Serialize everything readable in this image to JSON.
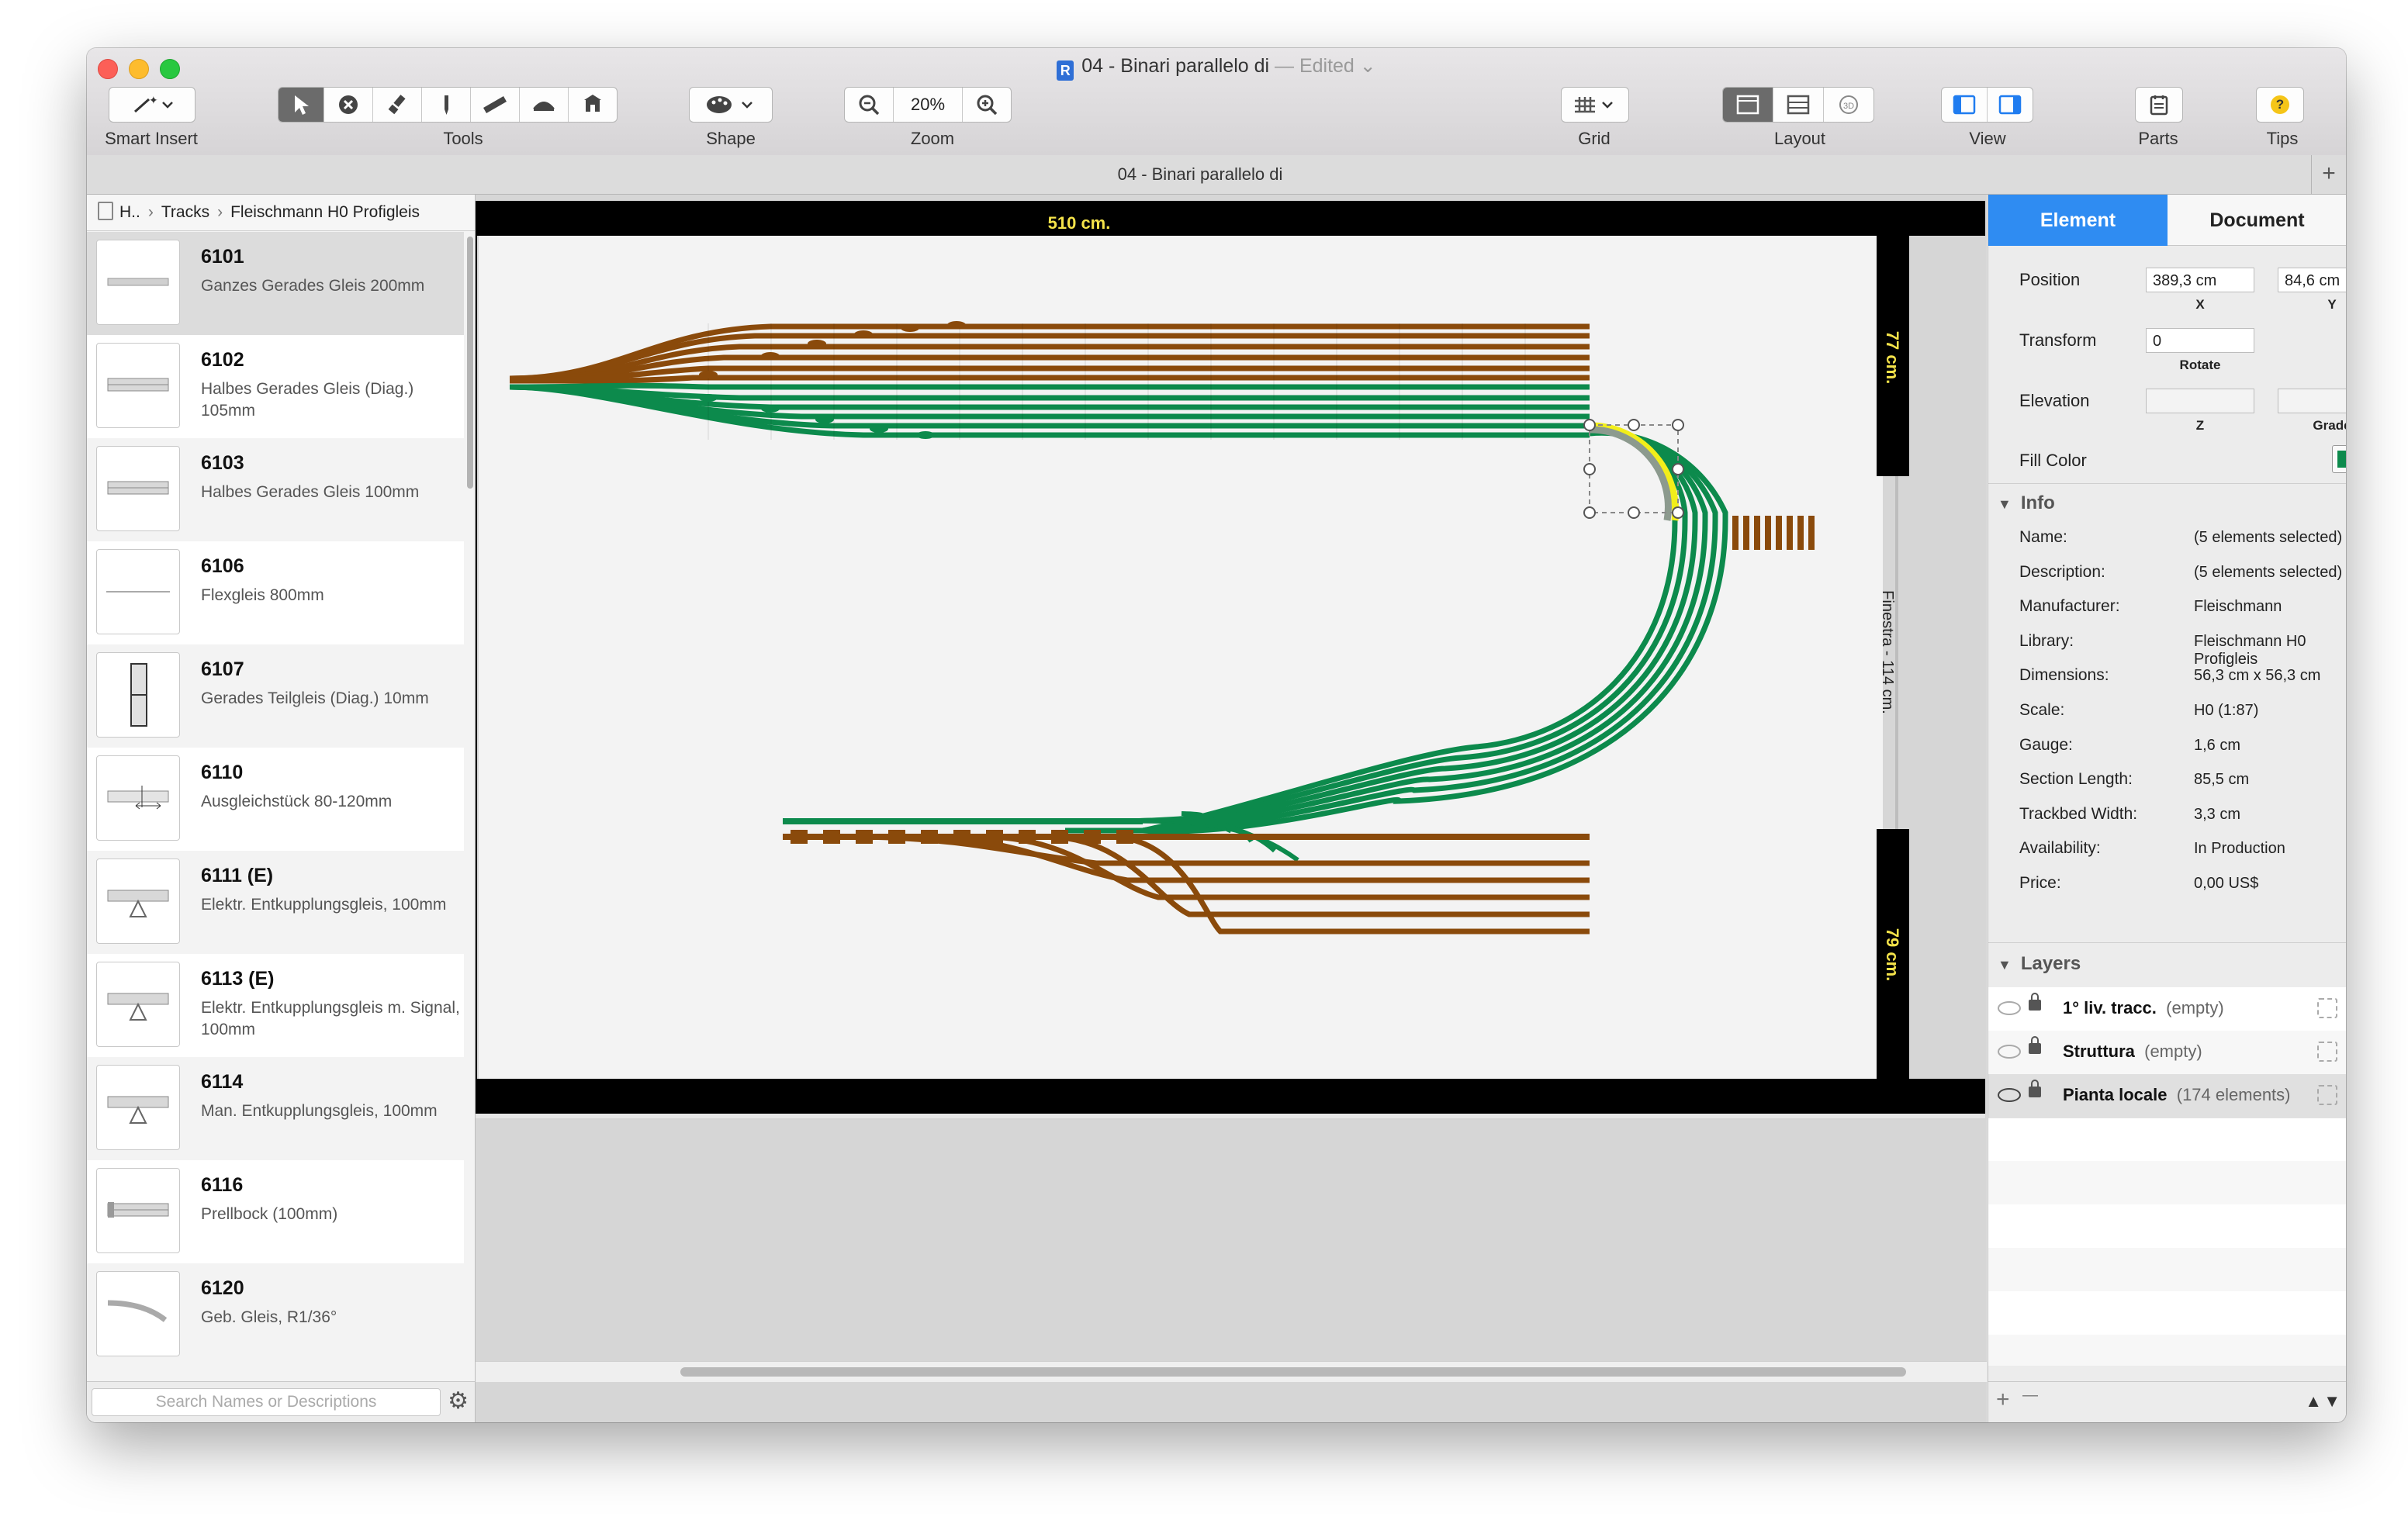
{
  "window": {
    "title": "04 - Binari parallelo di",
    "edited": " — Edited ⌄",
    "doc_icon_letter": "R"
  },
  "toolbar": {
    "smart_insert_label": "Smart Insert",
    "tools_label": "Tools",
    "shape_label": "Shape",
    "zoom_label": "Zoom",
    "zoom_value": "20%",
    "grid_label": "Grid",
    "layout_label": "Layout",
    "view_label": "View",
    "parts_label": "Parts",
    "tips_label": "Tips",
    "layout_3d": "3D",
    "tips_glyph": "?"
  },
  "tabbar": {
    "title": "04 - Binari parallelo di",
    "add": "+"
  },
  "sidebar": {
    "breadcrumb": [
      "H..",
      "Tracks",
      "Fleischmann H0 Profigleis"
    ],
    "items": [
      {
        "num": "6101",
        "desc": "Ganzes Gerades Gleis 200mm",
        "selected": true
      },
      {
        "num": "6102",
        "desc": "Halbes Gerades Gleis (Diag.) 105mm"
      },
      {
        "num": "6103",
        "desc": "Halbes Gerades Gleis 100mm"
      },
      {
        "num": "6106",
        "desc": "Flexgleis 800mm"
      },
      {
        "num": "6107",
        "desc": "Gerades Teilgleis (Diag.) 10mm"
      },
      {
        "num": "6110",
        "desc": "Ausgleichstück 80-120mm"
      },
      {
        "num": "6111 (E)",
        "desc": "Elektr. Entkupplungsgleis, 100mm"
      },
      {
        "num": "6113 (E)",
        "desc": "Elektr. Entkupplungsgleis m. Signal, 100mm"
      },
      {
        "num": "6114",
        "desc": "Man. Entkupplungsgleis, 100mm"
      },
      {
        "num": "6116",
        "desc": "Prellbock (100mm)"
      },
      {
        "num": "6120",
        "desc": "Geb. Gleis, R1/36°"
      }
    ],
    "search_placeholder": "Search Names or Descriptions",
    "gear_glyph": "⚙"
  },
  "canvas": {
    "top_dimension": "510 cm.",
    "right_dim_top": "77 cm.",
    "right_window": "Finestra - 114 cm.",
    "right_dim_bottom": "79 cm.",
    "colors": {
      "brown": "#8a4a0b",
      "green": "#0c8a4c",
      "highlight": "#f2ee1a",
      "grey_track": "#8c9a8e",
      "plan_bg": "#f3f3f3"
    }
  },
  "inspector": {
    "tab_element": "Element",
    "tab_document": "Document",
    "position_label": "Position",
    "pos_x": "389,3 cm",
    "pos_y": "84,6 cm",
    "x_sub": "X",
    "y_sub": "Y",
    "transform_label": "Transform",
    "rotate_value": "0",
    "rotate_sub": "Rotate",
    "elevation_label": "Elevation",
    "z_sub": "Z",
    "grade_sub": "Grade",
    "fill_label": "Fill Color",
    "fill_color": "#0c8a4c",
    "info_header": "Info",
    "info": [
      {
        "k": "Name:",
        "v": "(5 elements selected)"
      },
      {
        "k": "Description:",
        "v": "(5 elements selected)"
      },
      {
        "k": "Manufacturer:",
        "v": "Fleischmann"
      },
      {
        "k": "Library:",
        "v": "Fleischmann H0 Profigleis"
      },
      {
        "k": "Dimensions:",
        "v": "56,3 cm x 56,3 cm"
      },
      {
        "k": "Scale:",
        "v": "H0  (1:87)"
      },
      {
        "k": "Gauge:",
        "v": "1,6 cm"
      },
      {
        "k": "Section Length:",
        "v": "85,5 cm"
      },
      {
        "k": "Trackbed Width:",
        "v": "3,3 cm"
      },
      {
        "k": "Availability:",
        "v": "In Production"
      },
      {
        "k": "Price:",
        "v": "0,00 US$"
      }
    ],
    "layers_header": "Layers",
    "layers": [
      {
        "name": "1° liv. tracc.",
        "count": "(empty)",
        "visible": false
      },
      {
        "name": "Struttura",
        "count": "(empty)",
        "visible": false
      },
      {
        "name": "Pianta locale",
        "count": "(174 elements)",
        "visible": true
      }
    ],
    "add_glyph": "+",
    "remove_glyph": "—"
  }
}
